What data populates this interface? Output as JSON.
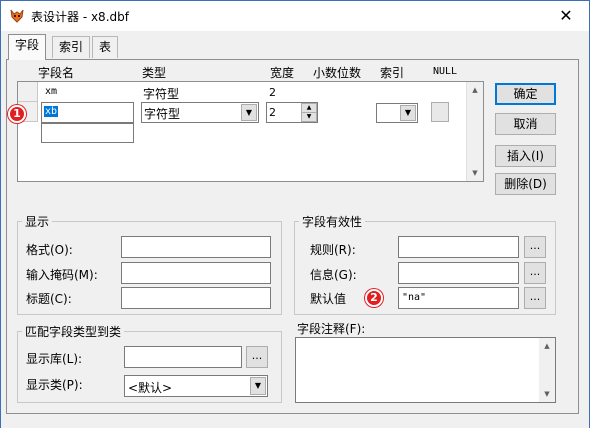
{
  "window": {
    "title": "表设计器 - x8.dbf",
    "close_glyph": "✕"
  },
  "tabs": [
    {
      "label": "字段"
    },
    {
      "label": "索引"
    },
    {
      "label": "表"
    }
  ],
  "grid": {
    "headers": {
      "name": "字段名",
      "type": "类型",
      "width": "宽度",
      "decimals": "小数位数",
      "index": "索引",
      "null": "NULL"
    },
    "rows": [
      {
        "name": "xm",
        "type": "字符型",
        "width": "2"
      },
      {
        "name": "xb",
        "type": "字符型",
        "width": "2"
      }
    ]
  },
  "buttons": {
    "ok": "确定",
    "cancel": "取消",
    "insert": "插入(I)",
    "delete": "删除(D)"
  },
  "display": {
    "title": "显示",
    "format_label": "格式(O):",
    "input_mask_label": "输入掩码(M):",
    "caption_label": "标题(C):"
  },
  "validation": {
    "title": "字段有效性",
    "rule_label": "规则(R):",
    "message_label": "信息(G):",
    "default_label": "默认值",
    "default_value": "\"na\"",
    "ellipsis": "..."
  },
  "mapping": {
    "title": "匹配字段类型到类",
    "library_label": "显示库(L):",
    "class_label": "显示类(P):",
    "class_value": "<默认>"
  },
  "comment": {
    "label": "字段注释(F):"
  },
  "badges": {
    "one": "1",
    "two": "2"
  },
  "colors": {
    "badge": "#e02020",
    "selection": "#0078d7"
  }
}
